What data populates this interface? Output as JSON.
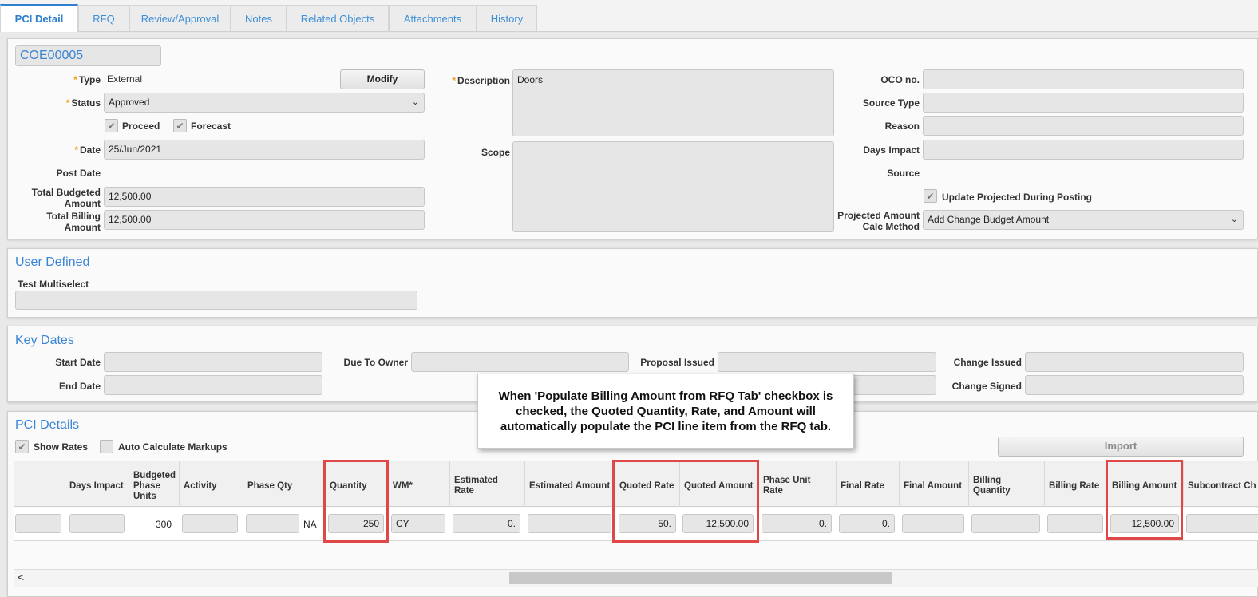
{
  "tabs": [
    "PCI Detail",
    "RFQ",
    "Review/Approval",
    "Notes",
    "Related Objects",
    "Attachments",
    "History"
  ],
  "header": {
    "code": "COE00005",
    "type_label": "Type",
    "type_value": "External",
    "modify_label": "Modify",
    "status_label": "Status",
    "status_value": "Approved",
    "proceed_label": "Proceed",
    "forecast_label": "Forecast",
    "date_label": "Date",
    "date_value": "25/Jun/2021",
    "post_date_label": "Post Date",
    "total_budgeted_label": "Total Budgeted Amount",
    "total_budgeted_value": "12,500.00",
    "total_billing_label": "Total Billing Amount",
    "total_billing_value": "12,500.00",
    "description_label": "Description",
    "description_value": "Doors",
    "scope_label": "Scope",
    "oco_label": "OCO no.",
    "source_type_label": "Source Type",
    "reason_label": "Reason",
    "days_impact_label": "Days Impact",
    "source_label": "Source",
    "update_projected_label": "Update Projected During Posting",
    "projected_calc_label": "Projected Amount Calc Method",
    "projected_calc_value": "Add Change Budget Amount"
  },
  "user_defined": {
    "title": "User Defined",
    "test_multiselect_label": "Test Multiselect"
  },
  "key_dates": {
    "title": "Key Dates",
    "start_date_label": "Start Date",
    "end_date_label": "End Date",
    "due_to_owner_label": "Due To Owner",
    "proposal_issued_label": "Proposal Issued",
    "change_issued_label": "Change Issued",
    "change_signed_label": "Change Signed"
  },
  "pci_details": {
    "title": "PCI Details",
    "show_rates_label": "Show Rates",
    "auto_calc_label": "Auto Calculate Markups",
    "import_label": "Import",
    "columns": [
      "Days Impact",
      "Budgeted Phase Units",
      "Activity",
      "Phase Qty",
      "Quantity",
      "WM*",
      "Estimated Rate",
      "Estimated Amount",
      "Quoted Rate",
      "Quoted Amount",
      "Phase Unit Rate",
      "Final Rate",
      "Final Amount",
      "Billing Quantity",
      "Billing Rate",
      "Billing Amount",
      "Subcontract Ch"
    ],
    "row": {
      "budgeted_phase_units": "300",
      "phase_qty_unit": "NA",
      "quantity": "250",
      "wm": "CY",
      "estimated_rate": "0.",
      "quoted_rate": "50.",
      "quoted_amount": "12,500.00",
      "phase_unit_rate": "0.",
      "final_rate": "0.",
      "billing_amount": "12,500.00"
    }
  },
  "callout": {
    "text": "When 'Populate Billing Amount from RFQ Tab' checkbox is checked, the Quoted Quantity, Rate, and Amount will automatically populate the PCI line item from the RFQ tab."
  },
  "scroll_left_icon": "<",
  "colors": {
    "accent": "#3a86d4",
    "highlight": "#e04848",
    "required": "#f39c12"
  }
}
